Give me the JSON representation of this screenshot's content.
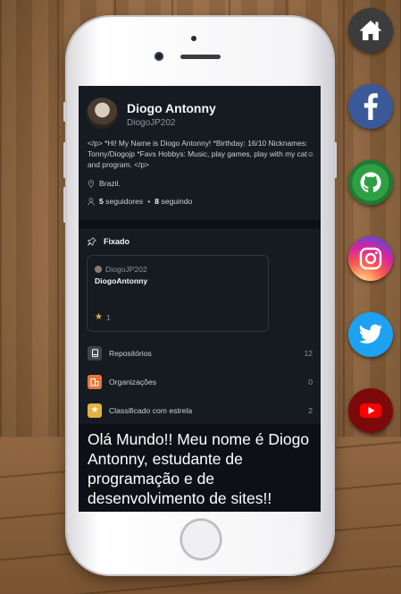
{
  "profile": {
    "name": "Diogo Antonny",
    "login": "DiogoJP202",
    "bio": "</p> *Hi! My Name is Diogo Antonny! *Birthday: 16/10 Nicknames: Tonny/Diogojp *Favs Hobbys: Music, play games, play with my cat☺ and program. </p>",
    "location": "Brazil.",
    "followers_count": "5",
    "followers_label": "seguidores",
    "separator": "•",
    "following_count": "8",
    "following_label": "seguindo"
  },
  "pinned": {
    "title": "Fixado",
    "card": {
      "owner": "DiogoJP202",
      "repo": "DiogoAntonny",
      "stars": "1"
    }
  },
  "menu": [
    {
      "label": "Repositórios",
      "count": "12",
      "icon": "repo-icon",
      "color": "#3d444d"
    },
    {
      "label": "Organizações",
      "count": "0",
      "icon": "organization-icon",
      "color": "#e8743b"
    },
    {
      "label": "Classificado com estrela",
      "count": "2",
      "icon": "star-icon",
      "color": "#e3b341"
    }
  ],
  "hello_text": "Olá Mundo!! Meu nome é Diogo Antonny, estudante de programação e de desenvolvimento de sites!!",
  "social_links": [
    {
      "icon": "home-icon",
      "color": "#3c3c3c"
    },
    {
      "icon": "facebook-icon",
      "color": "#3b5998"
    },
    {
      "icon": "github-icon",
      "color": "#2ea043"
    },
    {
      "icon": "instagram-icon",
      "color": "#d6249f"
    },
    {
      "icon": "twitter-icon",
      "color": "#1da1f2"
    },
    {
      "icon": "youtube-icon",
      "color": "#7d0a0a"
    }
  ]
}
